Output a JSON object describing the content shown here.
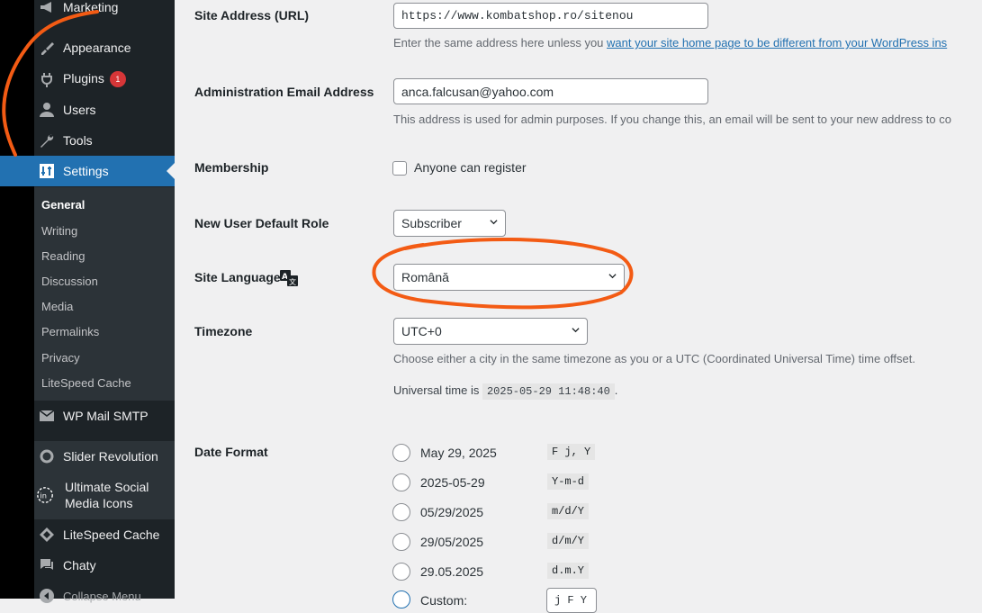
{
  "sidebar": {
    "items": [
      {
        "label": "Marketing",
        "icon": "megaphone-icon"
      },
      {
        "label": "Appearance",
        "icon": "paintbrush-icon"
      },
      {
        "label": "Plugins",
        "icon": "plug-icon",
        "badge": "1"
      },
      {
        "label": "Users",
        "icon": "user-icon"
      },
      {
        "label": "Tools",
        "icon": "wrench-icon"
      },
      {
        "label": "Settings",
        "icon": "settings-icon"
      }
    ],
    "submenu": [
      "General",
      "Writing",
      "Reading",
      "Discussion",
      "Media",
      "Permalinks",
      "Privacy",
      "LiteSpeed Cache"
    ],
    "lower_items": [
      {
        "label": "WP Mail SMTP",
        "icon": "mail-icon"
      },
      {
        "label": "Slider Revolution",
        "icon": "refresh-icon"
      },
      {
        "label": "Ultimate Social",
        "label2": "Media Icons",
        "icon": "social-icon"
      },
      {
        "label": "LiteSpeed Cache",
        "icon": "diamond-icon"
      },
      {
        "label": "Chaty",
        "icon": "chat-icon"
      },
      {
        "label": "Collapse Menu",
        "icon": "collapse-icon"
      }
    ]
  },
  "form": {
    "site_address": {
      "label": "Site Address (URL)",
      "value": "https://www.kombatshop.ro/sitenou",
      "desc_prefix": "Enter the same address here unless you ",
      "desc_link": "want your site home page to be different from your WordPress ins"
    },
    "admin_email": {
      "label": "Administration Email Address",
      "value": "anca.falcusan@yahoo.com",
      "desc": "This address is used for admin purposes. If you change this, an email will be sent to your new address to co"
    },
    "membership": {
      "label": "Membership",
      "checkbox_label": "Anyone can register"
    },
    "default_role": {
      "label": "New User Default Role",
      "value": "Subscriber"
    },
    "site_language": {
      "label": "Site Language",
      "value": "Română"
    },
    "timezone": {
      "label": "Timezone",
      "value": "UTC+0",
      "desc": "Choose either a city in the same timezone as you or a UTC (Coordinated Universal Time) time offset.",
      "universal_prefix": "Universal time is ",
      "universal_time": "2025-05-29 11:48:40",
      "universal_suffix": "."
    },
    "date_format": {
      "label": "Date Format",
      "options": [
        {
          "display": "May 29, 2025",
          "code": "F j, Y"
        },
        {
          "display": "2025-05-29",
          "code": "Y-m-d"
        },
        {
          "display": "05/29/2025",
          "code": "m/d/Y"
        },
        {
          "display": "29/05/2025",
          "code": "d/m/Y"
        },
        {
          "display": "29.05.2025",
          "code": "d.m.Y"
        },
        {
          "display": "Custom:",
          "code": "j F Y"
        }
      ]
    }
  },
  "colors": {
    "accent": "#2271b1",
    "annotation": "#f35b14",
    "badge": "#d63638"
  }
}
